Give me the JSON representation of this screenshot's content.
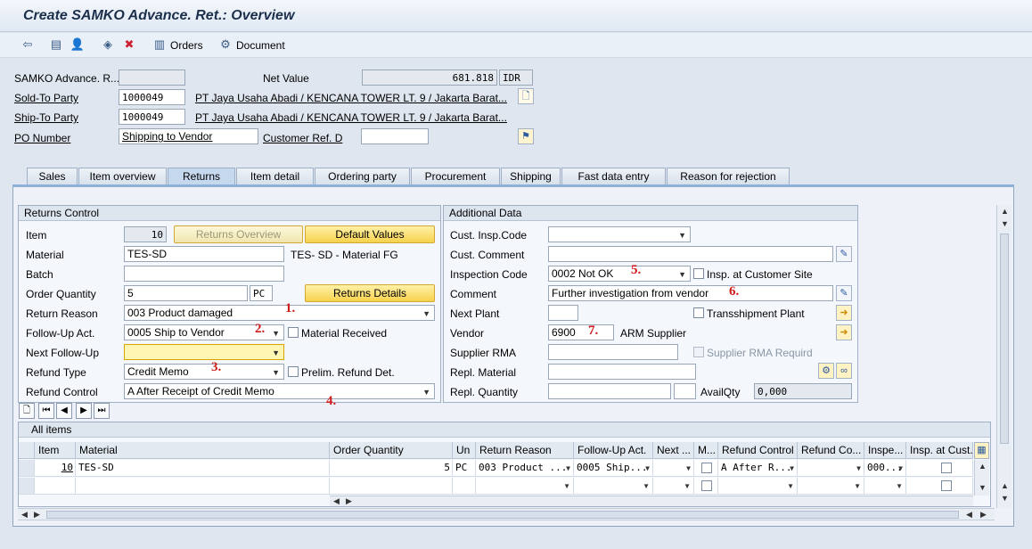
{
  "window": {
    "title": "Create SAMKO Advance. Ret.: Overview"
  },
  "toolbar": {
    "orders_label": "Orders",
    "document_label": "Document"
  },
  "header": {
    "doc_label": "SAMKO Advance. R...",
    "doc_value": "",
    "net_value_label": "Net Value",
    "net_value": "681.818",
    "currency": "IDR",
    "sold_to_label": "Sold-To Party",
    "sold_to_value": "1000049",
    "sold_to_desc": "PT Jaya Usaha Abadi / KENCANA TOWER LT. 9 / Jakarta Barat...",
    "ship_to_label": "Ship-To Party",
    "ship_to_value": "1000049",
    "ship_to_desc": "PT Jaya Usaha Abadi / KENCANA TOWER LT. 9 / Jakarta Barat...",
    "po_label": "PO Number",
    "po_value": "Shipping to Vendor",
    "cust_ref_label": "Customer Ref. D",
    "cust_ref_value": ""
  },
  "tabs": [
    "Sales",
    "Item overview",
    "Returns",
    "Item detail",
    "Ordering party",
    "Procurement",
    "Shipping",
    "Fast data entry",
    "Reason for rejection"
  ],
  "returns_control": {
    "title": "Returns Control",
    "item_label": "Item",
    "item_value": "10",
    "returns_overview_btn": "Returns Overview",
    "default_values_btn": "Default Values",
    "material_label": "Material",
    "material_value": "TES-SD",
    "material_desc": "TES- SD - Material FG",
    "batch_label": "Batch",
    "batch_value": "",
    "order_qty_label": "Order Quantity",
    "order_qty_value": "5",
    "order_qty_unit": "PC",
    "returns_details_btn": "Returns Details",
    "return_reason_label": "Return Reason",
    "return_reason_value": "003 Product damaged",
    "followup_label": "Follow-Up Act.",
    "followup_value": "0005 Ship to Vendor",
    "material_received_label": "Material Received",
    "next_followup_label": "Next Follow-Up",
    "next_followup_value": "",
    "refund_type_label": "Refund Type",
    "refund_type_value": "Credit Memo",
    "prelim_refund_label": "Prelim. Refund Det.",
    "refund_control_label": "Refund Control",
    "refund_control_value": "A After Receipt of Credit Memo"
  },
  "additional_data": {
    "title": "Additional Data",
    "cust_insp_label": "Cust. Insp.Code",
    "cust_insp_value": "",
    "cust_comment_label": "Cust. Comment",
    "cust_comment_value": "",
    "insp_code_label": "Inspection Code",
    "insp_code_value": "0002 Not OK",
    "insp_cust_site_label": "Insp. at Customer Site",
    "comment_label": "Comment",
    "comment_value": "Further investigation from vendor",
    "next_plant_label": "Next Plant",
    "next_plant_value": "",
    "transshipment_label": "Transshipment Plant",
    "vendor_label": "Vendor",
    "vendor_value": "6900",
    "vendor_desc": "ARM Supplier",
    "supplier_rma_label": "Supplier RMA",
    "supplier_rma_value": "",
    "supplier_rma_req_label": "Supplier RMA Requird",
    "repl_material_label": "Repl. Material",
    "repl_material_value": "",
    "repl_qty_label": "Repl. Quantity",
    "repl_qty_value": "",
    "avail_qty_label": "AvailQty",
    "avail_qty_value": "0,000"
  },
  "annotations": [
    "1.",
    "2.",
    "3.",
    "4.",
    "5.",
    "6.",
    "7."
  ],
  "all_items": {
    "title": "All items",
    "columns": [
      "Item",
      "Material",
      "Order Quantity",
      "Un",
      "Return Reason",
      "Follow-Up Act.",
      "Next ...",
      "M...",
      "Refund Control",
      "Refund Co...",
      "Inspe...",
      "Insp. at Cust..."
    ],
    "rows": [
      {
        "item": "10",
        "material": "TES-SD",
        "order_qty": "5",
        "unit": "PC",
        "return_reason": "003 Product ...",
        "followup": "0005 Ship...",
        "next": "",
        "refund_control": "A After R...",
        "refund_co": "",
        "inspection": "000..."
      }
    ]
  },
  "icons": {
    "toolbar": [
      "back-icon",
      "display-icon",
      "person-icon",
      "overview-icon",
      "delete-icon",
      "orders-icon",
      "document-icon"
    ],
    "colors": {
      "accent": "#8fb0d6",
      "button": "#f6d24d",
      "annotation": "#d01a1a"
    }
  }
}
